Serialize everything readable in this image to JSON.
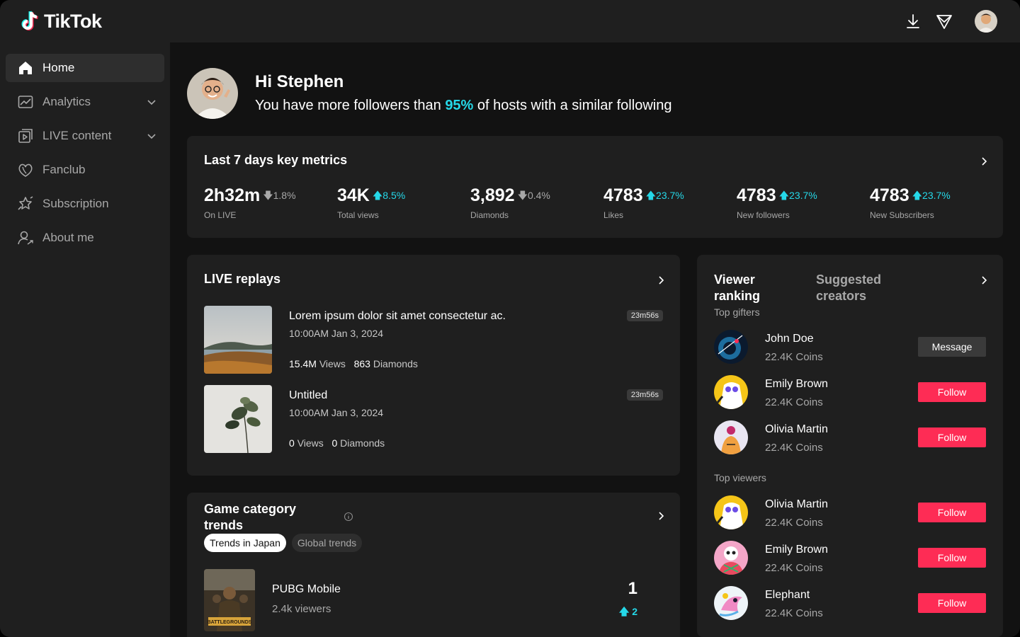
{
  "app": {
    "name": "TikTok"
  },
  "colors": {
    "accent": "#fe2c55",
    "highlight": "#25d8e8",
    "card": "#1f1f1f",
    "bg": "#121212"
  },
  "topbar": {
    "icons": [
      "download-icon",
      "send-icon",
      "avatar"
    ]
  },
  "sidebar": {
    "items": [
      {
        "label": "Home",
        "icon": "home-icon",
        "active": true
      },
      {
        "label": "Analytics",
        "icon": "chart-icon",
        "expandable": true
      },
      {
        "label": "LIVE content",
        "icon": "live-content-icon",
        "expandable": true
      },
      {
        "label": "Fanclub",
        "icon": "fanclub-icon"
      },
      {
        "label": "Subscription",
        "icon": "subscription-icon"
      },
      {
        "label": "About me",
        "icon": "user-icon"
      }
    ]
  },
  "hero": {
    "title": "Hi Stephen",
    "sub_before": "You have more followers than ",
    "sub_pct": "95%",
    "sub_after": " of hosts with a similar following"
  },
  "metrics": {
    "title": "Last 7 days key metrics",
    "items": [
      {
        "value": "2h32m",
        "delta": "1.8%",
        "dir": "down",
        "label": "On LIVE"
      },
      {
        "value": "34K",
        "delta": "8.5%",
        "dir": "up",
        "label": "Total views"
      },
      {
        "value": "3,892",
        "delta": "0.4%",
        "dir": "down",
        "label": "Diamonds"
      },
      {
        "value": "4783",
        "delta": "23.7%",
        "dir": "up",
        "label": "Likes"
      },
      {
        "value": "4783",
        "delta": "23.7%",
        "dir": "up",
        "label": "New followers"
      },
      {
        "value": "4783",
        "delta": "23.7%",
        "dir": "up",
        "label": "New Subscribers"
      }
    ]
  },
  "replays": {
    "title": "LIVE replays",
    "items": [
      {
        "title": "Lorem ipsum dolor sit amet consectetur ac.",
        "date": "10:00AM Jan 3, 2024",
        "views": "15.4M",
        "views_label": "Views",
        "diamonds": "863",
        "diamonds_label": "Diamonds",
        "duration": "23m56s"
      },
      {
        "title": "Untitled",
        "date": "10:00AM Jan 3, 2024",
        "views": "0",
        "views_label": "Views",
        "diamonds": "0",
        "diamonds_label": "Diamonds",
        "duration": "23m56s"
      }
    ]
  },
  "trends": {
    "title": "Game category trends",
    "tabs": [
      {
        "label": "Trends in Japan",
        "active": true
      },
      {
        "label": "Global trends",
        "active": false
      }
    ],
    "games": [
      {
        "title": "PUBG Mobile",
        "viewers": "2.4k viewers",
        "rank": "1",
        "change": "2"
      }
    ]
  },
  "ranking": {
    "tab_active": "Viewer ranking",
    "tab_inactive": "Suggested creators",
    "gifters_label": "Top gifters",
    "viewers_label": "Top viewers",
    "gifters": [
      {
        "name": "John Doe",
        "coins": "22.4K Coins",
        "action": "Message",
        "style": "message"
      },
      {
        "name": "Emily Brown",
        "coins": "22.4K Coins",
        "action": "Follow",
        "style": "follow"
      },
      {
        "name": "Olivia Martin",
        "coins": "22.4K Coins",
        "action": "Follow",
        "style": "follow"
      }
    ],
    "viewers": [
      {
        "name": "Olivia Martin",
        "coins": "22.4K Coins",
        "action": "Follow",
        "style": "follow"
      },
      {
        "name": "Emily Brown",
        "coins": "22.4K Coins",
        "action": "Follow",
        "style": "follow"
      },
      {
        "name": "Elephant",
        "coins": "22.4K Coins",
        "action": "Follow",
        "style": "follow"
      }
    ]
  }
}
